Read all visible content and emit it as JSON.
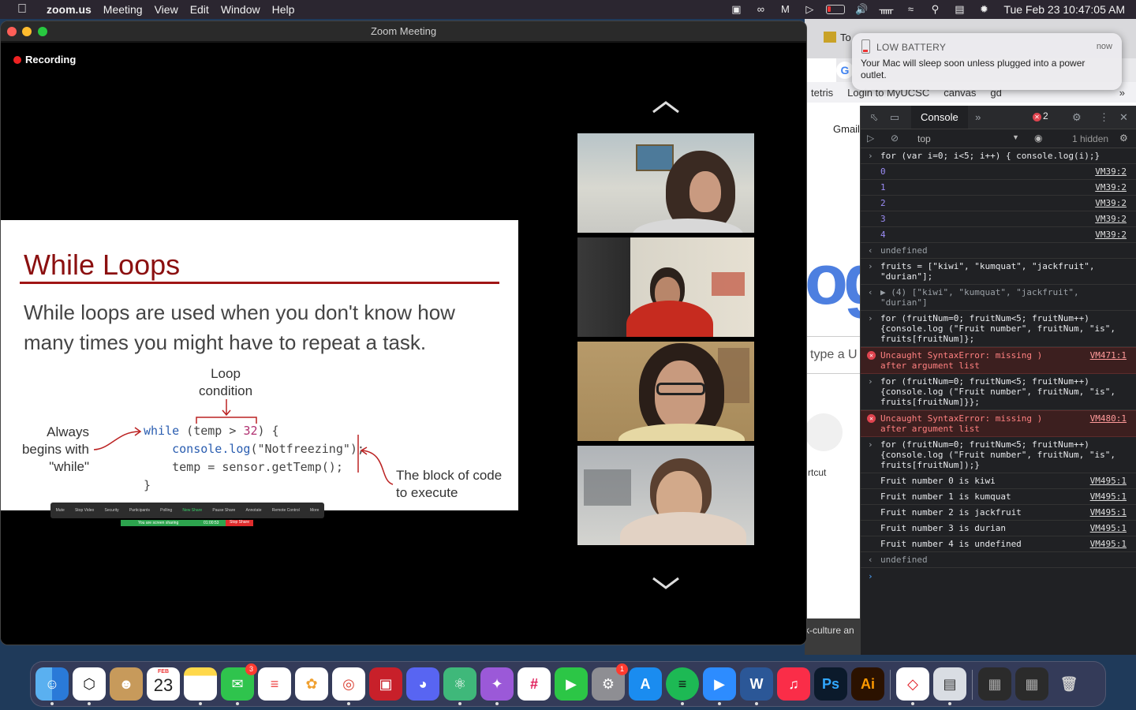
{
  "menubar": {
    "app_name": "zoom.us",
    "items": [
      "Meeting",
      "View",
      "Edit",
      "Window",
      "Help"
    ],
    "clock": "Tue Feb 23  10:47:05 AM"
  },
  "notification": {
    "title": "LOW BATTERY",
    "time": "now",
    "body": "Your Mac will sleep soon unless plugged into a power outlet."
  },
  "browser": {
    "tab_partial": "To",
    "bookmarks": [
      "tetris",
      "Login to MyUCSC",
      "canvas",
      "gd"
    ],
    "gmail_link": "Gmail",
    "logo_partial": "og",
    "search_partial": "type a U",
    "shortcut_partial": "rtcut",
    "footer_partial": "k-culture an"
  },
  "devtools": {
    "console_tab": "Console",
    "error_count": "2",
    "context": "top",
    "hidden": "1 hidden",
    "rows": [
      {
        "kind": "input",
        "text": "for (var i=0; i<5; i++) {    console.log(i);}"
      },
      {
        "kind": "log",
        "text": "0",
        "src": "VM39:2"
      },
      {
        "kind": "log",
        "text": "1",
        "src": "VM39:2"
      },
      {
        "kind": "log",
        "text": "2",
        "src": "VM39:2"
      },
      {
        "kind": "log",
        "text": "3",
        "src": "VM39:2"
      },
      {
        "kind": "log",
        "text": "4",
        "src": "VM39:2"
      },
      {
        "kind": "return",
        "text": "undefined"
      },
      {
        "kind": "input",
        "text": "fruits = [\"kiwi\", \"kumquat\", \"jackfruit\", \"durian\"];"
      },
      {
        "kind": "return",
        "text": "▶ (4) [\"kiwi\", \"kumquat\", \"jackfruit\", \"durian\"]"
      },
      {
        "kind": "input",
        "text": "for (fruitNum=0; fruitNum<5; fruitNum++) {console.log (\"Fruit number\", fruitNum, \"is\", fruits[fruitNum]};"
      },
      {
        "kind": "error",
        "text": "Uncaught SyntaxError: missing ) after argument list",
        "src": "VM471:1"
      },
      {
        "kind": "input",
        "text": "for (fruitNum=0; fruitNum<5; fruitNum++) {console.log (\"Fruit number\", fruitNum, \"is\", fruits[fruitNum]}};"
      },
      {
        "kind": "error",
        "text": "Uncaught SyntaxError: missing ) after argument list",
        "src": "VM480:1"
      },
      {
        "kind": "input",
        "text": "for (fruitNum=0; fruitNum<5; fruitNum++) {console.log (\"Fruit number\", fruitNum, \"is\", fruits[fruitNum]);}"
      },
      {
        "kind": "log",
        "text": "Fruit number 0 is kiwi",
        "src": "VM495:1"
      },
      {
        "kind": "log",
        "text": "Fruit number 1 is kumquat",
        "src": "VM495:1"
      },
      {
        "kind": "log",
        "text": "Fruit number 2 is jackfruit",
        "src": "VM495:1"
      },
      {
        "kind": "log",
        "text": "Fruit number 3 is durian",
        "src": "VM495:1"
      },
      {
        "kind": "log",
        "text": "Fruit number 4 is undefined",
        "src": "VM495:1"
      },
      {
        "kind": "return",
        "text": "undefined"
      }
    ]
  },
  "zoom": {
    "window_title": "Zoom Meeting",
    "recording": "Recording",
    "slide": {
      "title": "While Loops",
      "body": "While loops are used when you don't know how many times you might have to repeat a task.",
      "loop_condition": "Loop condition",
      "always_label": "Always begins with \"while\"",
      "block_label": "The block of code to execute",
      "code": {
        "line1_kw": "while",
        "line1_a": " (temp > ",
        "line1_num": "32",
        "line1_b": ") {",
        "line2_obj": "console.",
        "line2_fn": "log",
        "line2_arg": "(\"Notfreezing\");",
        "line3": "temp = sensor.getTemp();",
        "line4": "}"
      }
    },
    "mini_toolbar": [
      "Mute",
      "Stop Video",
      "Security",
      "Participants",
      "Polling",
      "New Share",
      "Pause Share",
      "Annotate",
      "Remote Control",
      "More"
    ],
    "share_banner": "You are screen sharing",
    "share_timer": "01:00:53",
    "stop_share": "Stop Share",
    "participant_count": "26"
  },
  "dock": {
    "calendar_month": "FEB",
    "calendar_day": "23",
    "messages_badge": "3",
    "settings_badge": "1",
    "apps": [
      "Finder",
      "Unity Hub",
      "Contacts",
      "Calendar",
      "Notes",
      "Messages",
      "Reminders",
      "Photos",
      "Chrome",
      "Photo Booth",
      "Discord",
      "Atom",
      "GitHub Desktop",
      "Slack",
      "FaceTime",
      "System Preferences",
      "App Store",
      "Spotify",
      "Zoom",
      "Word",
      "Music",
      "Photoshop",
      "Illustrator",
      "Acrobat",
      "Preview",
      "Window",
      "Window",
      "Trash"
    ]
  }
}
